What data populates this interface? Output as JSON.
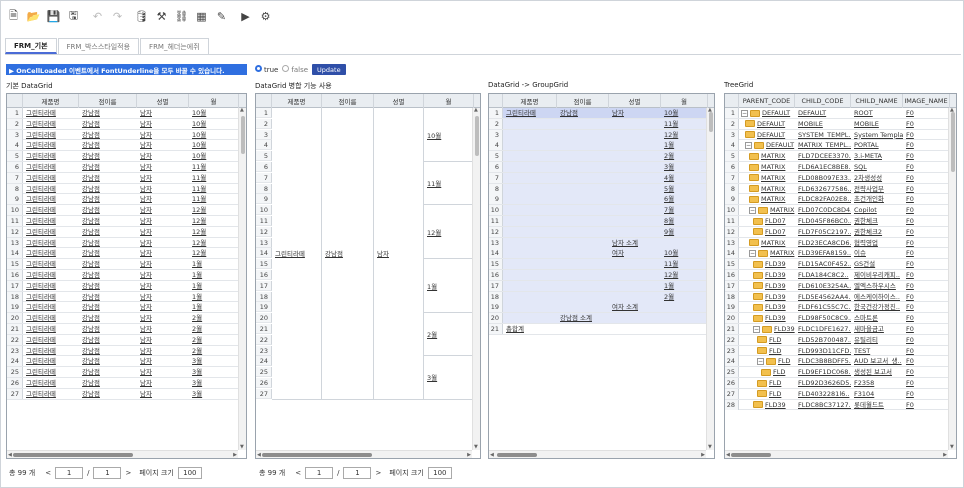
{
  "toolbar": {
    "icons": [
      "file-icon",
      "folder-open-icon",
      "save-icon",
      "save-as-icon",
      "undo-icon",
      "redo-icon",
      "database-icon",
      "tools-icon",
      "hierarchy-icon",
      "layout-icon",
      "edit-icon",
      "play-icon",
      "gear-icon"
    ]
  },
  "tabs": [
    "FRM_기본",
    "FRM_박스스타일적용",
    "FRM_헤더는에쥐"
  ],
  "banner": "▶ OnCellLoaded 이벤트에서 FontUnderline을 모두 바꿀 수 있습니다.",
  "radios": {
    "opt_true": "true",
    "opt_false": "false",
    "button": "Update"
  },
  "titles": {
    "grid1": "기본 DataGrid",
    "grid2": "DataGrid 병합 기능 사용",
    "grid3": "DataGrid -> GroupGrid",
    "grid4": "TreeGrid"
  },
  "grid_headers": [
    "제품명",
    "점이름",
    "성별",
    "월"
  ],
  "tree_headers": [
    "PARENT_CODE",
    "CHILD_CODE",
    "CHILD_NAME",
    "IMAGE_NAME"
  ],
  "grid1_rows": [
    [
      "1",
      "그린티라떼",
      "강남점",
      "남자",
      "10월"
    ],
    [
      "2",
      "그린티라떼",
      "강남점",
      "남자",
      "10월"
    ],
    [
      "3",
      "그린티라떼",
      "강남점",
      "남자",
      "10월"
    ],
    [
      "4",
      "그린티라떼",
      "강남점",
      "남자",
      "10월"
    ],
    [
      "5",
      "그린티라떼",
      "강남점",
      "남자",
      "10월"
    ],
    [
      "6",
      "그린티라떼",
      "강남점",
      "남자",
      "11월"
    ],
    [
      "7",
      "그린티라떼",
      "강남점",
      "남자",
      "11월"
    ],
    [
      "8",
      "그린티라떼",
      "강남점",
      "남자",
      "11월"
    ],
    [
      "9",
      "그린티라떼",
      "강남점",
      "남자",
      "11월"
    ],
    [
      "10",
      "그린티라떼",
      "강남점",
      "남자",
      "12월"
    ],
    [
      "11",
      "그린티라떼",
      "강남점",
      "남자",
      "12월"
    ],
    [
      "12",
      "그린티라떼",
      "강남점",
      "남자",
      "12월"
    ],
    [
      "13",
      "그린티라떼",
      "강남점",
      "남자",
      "12월"
    ],
    [
      "14",
      "그린티라떼",
      "강남점",
      "남자",
      "12월"
    ],
    [
      "15",
      "그린티라떼",
      "강남점",
      "남자",
      "1월"
    ],
    [
      "16",
      "그린티라떼",
      "강남점",
      "남자",
      "1월"
    ],
    [
      "17",
      "그린티라떼",
      "강남점",
      "남자",
      "1월"
    ],
    [
      "18",
      "그린티라떼",
      "강남점",
      "남자",
      "1월"
    ],
    [
      "19",
      "그린티라떼",
      "강남점",
      "남자",
      "1월"
    ],
    [
      "20",
      "그린티라떼",
      "강남점",
      "남자",
      "2월"
    ],
    [
      "21",
      "그린티라떼",
      "강남점",
      "남자",
      "2월"
    ],
    [
      "22",
      "그린티라떼",
      "강남점",
      "남자",
      "2월"
    ],
    [
      "23",
      "그린티라떼",
      "강남점",
      "남자",
      "2월"
    ],
    [
      "24",
      "그린티라떼",
      "강남점",
      "남자",
      "3월"
    ],
    [
      "25",
      "그린티라떼",
      "강남점",
      "남자",
      "3월"
    ],
    [
      "26",
      "그린티라떼",
      "강남점",
      "남자",
      "3월"
    ],
    [
      "27",
      "그린티라떼",
      "강남점",
      "남자",
      "3월"
    ]
  ],
  "grid2_rownums": [
    "1",
    "2",
    "3",
    "4",
    "5",
    "6",
    "7",
    "8",
    "9",
    "10",
    "11",
    "12",
    "13",
    "14",
    "15",
    "16",
    "17",
    "18",
    "19",
    "20",
    "21",
    "22",
    "23",
    "24",
    "25",
    "26",
    "27"
  ],
  "grid2_merge": {
    "product": "그린티라떼",
    "store": "강남점",
    "gender": "남자",
    "months": [
      [
        "10월",
        1,
        5
      ],
      [
        "11월",
        6,
        9
      ],
      [
        "12월",
        10,
        14
      ],
      [
        "1월",
        15,
        19
      ],
      [
        "2월",
        20,
        23
      ],
      [
        "3월",
        24,
        27
      ]
    ]
  },
  "grid3_rows": [
    [
      "1",
      "그린티라떼",
      "강남점",
      "남자",
      "10월"
    ],
    [
      "2",
      "",
      "",
      "",
      "11월"
    ],
    [
      "3",
      "",
      "",
      "",
      "12월"
    ],
    [
      "4",
      "",
      "",
      "",
      "1월"
    ],
    [
      "5",
      "",
      "",
      "",
      "2월"
    ],
    [
      "6",
      "",
      "",
      "",
      "3월"
    ],
    [
      "7",
      "",
      "",
      "",
      "4월"
    ],
    [
      "8",
      "",
      "",
      "",
      "5월"
    ],
    [
      "9",
      "",
      "",
      "",
      "6월"
    ],
    [
      "10",
      "",
      "",
      "",
      "7월"
    ],
    [
      "11",
      "",
      "",
      "",
      "8월"
    ],
    [
      "12",
      "",
      "",
      "",
      "9월"
    ],
    [
      "13",
      "",
      "",
      "남자 소계",
      ""
    ],
    [
      "14",
      "",
      "",
      "여자",
      "10월"
    ],
    [
      "15",
      "",
      "",
      "",
      "11월"
    ],
    [
      "16",
      "",
      "",
      "",
      "12월"
    ],
    [
      "17",
      "",
      "",
      "",
      "1월"
    ],
    [
      "18",
      "",
      "",
      "",
      "2월"
    ],
    [
      "19",
      "",
      "",
      "여자 소계",
      ""
    ],
    [
      "20",
      "",
      "강남점 소계",
      "",
      ""
    ],
    [
      "21",
      "총합계",
      "",
      "",
      ""
    ]
  ],
  "grid4_rows": [
    [
      "1",
      "DEFAULT",
      "DEFAULT",
      "ROOT",
      "F0",
      "0",
      "e"
    ],
    [
      "2",
      "DEFAULT",
      "MOBILE",
      "MOBILE",
      "F0",
      "1",
      ""
    ],
    [
      "3",
      "DEFAULT",
      "SYSTEM_TEMPL..",
      "System Template",
      "F0",
      "1",
      ""
    ],
    [
      "4",
      "DEFAULT",
      "MATRIX_TEMPL..",
      "PORTAL",
      "F0",
      "1",
      "e"
    ],
    [
      "5",
      "MATRIX",
      "FLD7DCEE3370..",
      "3.i-META",
      "F0",
      "2",
      ""
    ],
    [
      "6",
      "MATRIX",
      "FLD6A1EC8BE8..",
      "SQL",
      "F0",
      "2",
      ""
    ],
    [
      "7",
      "MATRIX",
      "FLD08B097E33..",
      "2차생성성",
      "F0",
      "2",
      ""
    ],
    [
      "8",
      "MATRIX",
      "FLD632677586..",
      "전략사업부",
      "F0",
      "2",
      ""
    ],
    [
      "9",
      "MATRIX",
      "FLDC82FA02E8..",
      "초건개인화",
      "F0",
      "2",
      ""
    ],
    [
      "10",
      "MATRIX",
      "FLD07C0DC8D4..",
      "Copilot",
      "F0",
      "2",
      "e"
    ],
    [
      "11",
      "FLD07",
      "FLD045F86BC0..",
      "권한체크",
      "F0",
      "3",
      ""
    ],
    [
      "12",
      "FLD07",
      "FLD7F05C2197..",
      "권한체크2",
      "F0",
      "3",
      ""
    ],
    [
      "13",
      "MATRIX",
      "FLD23ECA8CD6..",
      "협력영업",
      "F0",
      "2",
      ""
    ],
    [
      "14",
      "MATRIX",
      "FLD39EFA8159..",
      "이슈",
      "F0",
      "2",
      "e"
    ],
    [
      "15",
      "FLD39",
      "FLD15AC0F452..",
      "GS건설",
      "F0",
      "3",
      ""
    ],
    [
      "16",
      "FLD39",
      "FLDA184C8C2..",
      "제이비우리캐피..",
      "F0",
      "3",
      ""
    ],
    [
      "17",
      "FLD39",
      "FLD610E3254A..",
      "엘엑스하우시스",
      "F0",
      "3",
      ""
    ],
    [
      "18",
      "FLD39",
      "FLD5E4562AA4..",
      "에스케이하이스..",
      "F0",
      "3",
      ""
    ],
    [
      "19",
      "FLD39",
      "FLDF61C55C7C..",
      "한국건강가정진..",
      "F0",
      "3",
      ""
    ],
    [
      "20",
      "FLD39",
      "FLD98F50C8C9..",
      "스마트론",
      "F0",
      "3",
      ""
    ],
    [
      "21",
      "FLD39",
      "FLDC1DFE1627..",
      "새마을금고",
      "F0",
      "3",
      "e"
    ],
    [
      "22",
      "FLD",
      "FLD52B700487..",
      "유틸리티",
      "F0",
      "4",
      ""
    ],
    [
      "23",
      "FLD",
      "FLD993D11CFD..",
      "TEST",
      "F0",
      "4",
      ""
    ],
    [
      "24",
      "FLD",
      "FLDC3B8BDFF5..",
      "AUD 보고서_생..",
      "F0",
      "4",
      "e"
    ],
    [
      "25",
      "FLD",
      "FLD9EF1DC068..",
      "생성된 보고서",
      "F0",
      "5",
      ""
    ],
    [
      "26",
      "FLD",
      "FLD92D3626D5..",
      "F2358",
      "F0",
      "4",
      ""
    ],
    [
      "27",
      "FLD",
      "FLD4032281l6..",
      "F3104",
      "F0",
      "4",
      ""
    ],
    [
      "28",
      "FLD39",
      "FLDC8BC37127..",
      "롯데월드트",
      "F0",
      "3",
      ""
    ]
  ],
  "pager1": {
    "total": "총 99 개",
    "cur": "1",
    "sep": "/",
    "pages": "1",
    "size_label": "페이지 크기",
    "size": "100"
  },
  "pager2": {
    "total": "총 99 개",
    "cur": "1",
    "sep": "/",
    "pages": "1",
    "size_label": "페이지 크기",
    "size": "100"
  },
  "colors": {
    "accent": "#2f6fe0",
    "header": "#e9edf1",
    "group_hl": "#e3e8f8"
  }
}
